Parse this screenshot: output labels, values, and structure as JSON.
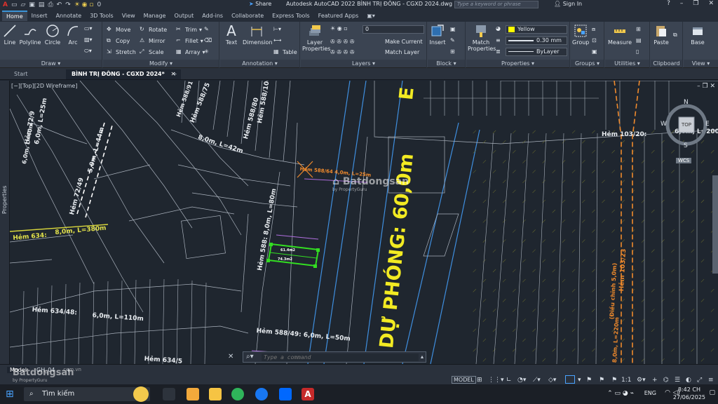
{
  "titlebar": {
    "app_title": "Autodesk AutoCAD 2022   BÌNH TRỊ ĐÔNG - CGXD 2024.dwg",
    "share_label": "Share",
    "search_placeholder": "Type a keyword or phrase",
    "signin_label": "Sign In",
    "layer_quick": "0"
  },
  "ribbon_tabs": [
    "Home",
    "Insert",
    "Annotate",
    "3D Tools",
    "View",
    "Manage",
    "Output",
    "Add-ins",
    "Collaborate",
    "Express Tools",
    "Featured Apps"
  ],
  "ribbon": {
    "draw": {
      "title": "Draw",
      "line": "Line",
      "polyline": "Polyline",
      "circle": "Circle",
      "arc": "Arc"
    },
    "modify": {
      "title": "Modify",
      "move": "Move",
      "rotate": "Rotate",
      "trim": "Trim",
      "copy": "Copy",
      "mirror": "Mirror",
      "fillet": "Fillet",
      "stretch": "Stretch",
      "scale": "Scale",
      "array": "Array"
    },
    "annotation": {
      "title": "Annotation",
      "text": "Text",
      "dimension": "Dimension",
      "table": "Table"
    },
    "layers": {
      "title": "Layers",
      "layer_properties": "Layer Properties",
      "current_layer": "0",
      "make_current": "Make Current",
      "match_layer": "Match Layer"
    },
    "block": {
      "title": "Block",
      "insert": "Insert"
    },
    "properties": {
      "title": "Properties",
      "match_properties": "Match Properties",
      "color": "Yellow",
      "lineweight": "0.30 mm",
      "linetype": "ByLayer"
    },
    "groups": {
      "title": "Groups",
      "group": "Group"
    },
    "utilities": {
      "title": "Utilities",
      "measure": "Measure"
    },
    "clipboard": {
      "title": "Clipboard",
      "paste": "Paste"
    },
    "view": {
      "title": "View",
      "base": "Base"
    }
  },
  "doc_tabs": {
    "start": "Start",
    "active": "BÌNH TRỊ ĐÔNG - CGXD 2024*"
  },
  "viewport": {
    "label": "[−][Top][2D Wireframe]",
    "viewcube_top": "TOP",
    "wcs": "WCS",
    "compass": {
      "n": "N",
      "s": "S",
      "e": "E",
      "w": "W"
    }
  },
  "side_palette": "Properties",
  "drawing": {
    "road_big": "DỰ PHÓNG:  60,0m",
    "road_letter": "E",
    "streets": [
      "Hẻm 588/75",
      "8,0m, L=42m",
      "Hẻm 588/80",
      "Hẻm 588/100",
      "Hẻm 72/9",
      "6,0m, L=25m",
      "Hẻm 72/49",
      "5,0m, L=44m",
      "Hẻm 634:",
      "8,0m, L=380m",
      "Hẻm 588/64 4,0m, L=25m",
      "Hẻm 588: 8,0m, L=80m",
      "Hẻm 634/48:",
      "6,0m, L=110m",
      "Hẻm 588/49: 6,0m, L=50m",
      "Hẻm 634/5",
      "Hẻm 103/20:",
      "6,0m, L=200m",
      "Hẻm 103/23",
      "(Điều chỉnh 5,0m)",
      "8,0m, L=220m",
      "Hẻm 588/91",
      "6,0m, L=40m"
    ],
    "lot_label_1": "61.4m2",
    "lot_label_2": "74.3m2"
  },
  "watermark": {
    "brand": "Batdongsan",
    "sub": "by PropertyGuru",
    "site": ".com.vn"
  },
  "command_placeholder": "Type a command",
  "layout_tabs": [
    "Model",
    "GH_04"
  ],
  "statusbar": {
    "model": "MODEL",
    "scale": "1:1"
  },
  "taskbar": {
    "search": "Tìm kiếm",
    "lang": "ENG",
    "time": "8:42 CH",
    "date": "27/06/2025"
  }
}
